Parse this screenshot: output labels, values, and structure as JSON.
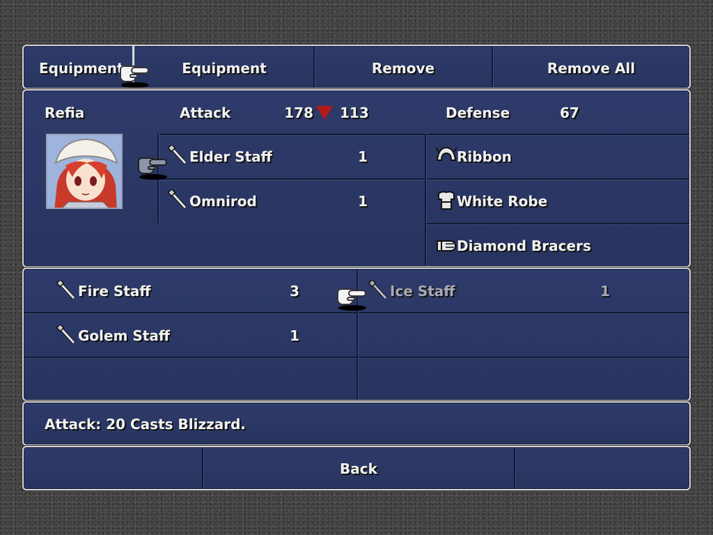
{
  "tabs": {
    "title": "Equipment",
    "equipment_label": "Equipment",
    "remove_label": "Remove",
    "remove_all_label": "Remove All"
  },
  "character": {
    "name": "Refia",
    "attack_label": "Attack",
    "attack_current": "178",
    "attack_new": "113",
    "defense_label": "Defense",
    "defense_value": "67"
  },
  "equipped": {
    "weapons": [
      {
        "name": "Elder Staff",
        "qty": "1",
        "icon": "staff-icon"
      },
      {
        "name": "Omnirod",
        "qty": "1",
        "icon": "staff-icon"
      }
    ],
    "armor": [
      {
        "name": "Ribbon",
        "icon": "helmet-icon"
      },
      {
        "name": "White Robe",
        "icon": "robe-icon"
      },
      {
        "name": "Diamond Bracers",
        "icon": "bracer-icon"
      }
    ]
  },
  "inventory": [
    {
      "name": "Fire Staff",
      "qty": "3",
      "icon": "staff-icon",
      "disabled": false
    },
    {
      "name": "Ice Staff",
      "qty": "1",
      "icon": "staff-icon",
      "disabled": true
    },
    {
      "name": "Golem Staff",
      "qty": "1",
      "icon": "staff-icon",
      "disabled": false
    }
  ],
  "description": "Attack: 20  Casts Blizzard.",
  "footer": {
    "back_label": "Back"
  },
  "colors": {
    "panel": "#2e3b6a",
    "border": "#d8d8d8",
    "text": "#f2f2f2",
    "disabled_text": "#a9a9b4",
    "stat_down": "#b31a1a"
  }
}
